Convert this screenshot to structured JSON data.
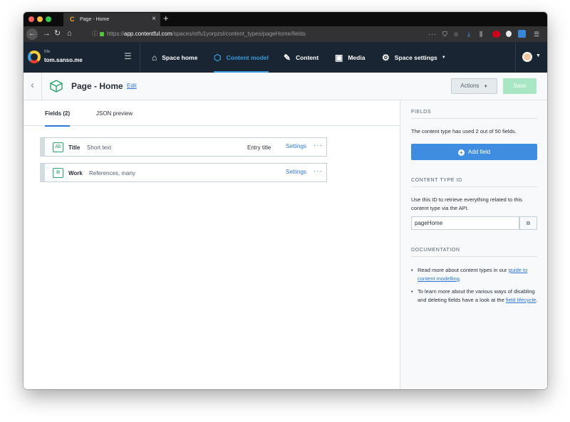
{
  "browser": {
    "tab_title": "Page - Home",
    "tab_favicon": "C",
    "tab_close": "×",
    "new_tab": "+",
    "url_prefix": "https://",
    "url_host": "app.contentful.com",
    "url_path": "/spaces/otfu1yorpzsl/content_types/pageHome/fields",
    "toolbar_more": "···",
    "colors": {
      "tabbar": "#0c0c0d",
      "navbar": "#323234"
    }
  },
  "app_header": {
    "org_label": "Me",
    "space_name": "tom.sanso.me",
    "nav": [
      {
        "label": "Space home",
        "icon": "house-icon"
      },
      {
        "label": "Content model",
        "icon": "cube-icon",
        "active": true
      },
      {
        "label": "Content",
        "icon": "pencil-icon"
      },
      {
        "label": "Media",
        "icon": "image-icon"
      },
      {
        "label": "Space settings",
        "icon": "gear-icon",
        "dropdown": true
      }
    ],
    "colors": {
      "background": "#192532",
      "active": "#3a9bdc"
    }
  },
  "workbench": {
    "title": "Page - Home",
    "edit_label": "Edit",
    "actions_label": "Actions",
    "save_label": "Save"
  },
  "tabs": [
    {
      "label": "Fields (2)",
      "active": true
    },
    {
      "label": "JSON preview"
    }
  ],
  "fields": [
    {
      "icon_text": "Ab",
      "name": "Title",
      "type": "Short text",
      "entry_title": "Entry title",
      "settings": "Settings",
      "more": "···"
    },
    {
      "icon_text": "⧉",
      "name": "Work",
      "type": "References, many",
      "entry_title": "",
      "settings": "Settings",
      "more": "···"
    }
  ],
  "sidebar": {
    "fields_heading": "FIELDS",
    "fields_text": "The content type has used 2 out of 50 fields.",
    "add_field_label": "Add field",
    "ct_id_heading": "CONTENT TYPE ID",
    "ct_id_text": "Use this ID to retrieve everything related to this content type via the API.",
    "ct_id_value": "pageHome",
    "docs_heading": "DOCUMENTATION",
    "doc1_pre": "Read more about content types in our ",
    "doc1_link": "guide to content modelling",
    "doc1_post": ".",
    "doc2_pre": "To learn more about the various ways of disabling and deleting fields have a look at the ",
    "doc2_link": "field lifecycle",
    "doc2_post": "."
  }
}
